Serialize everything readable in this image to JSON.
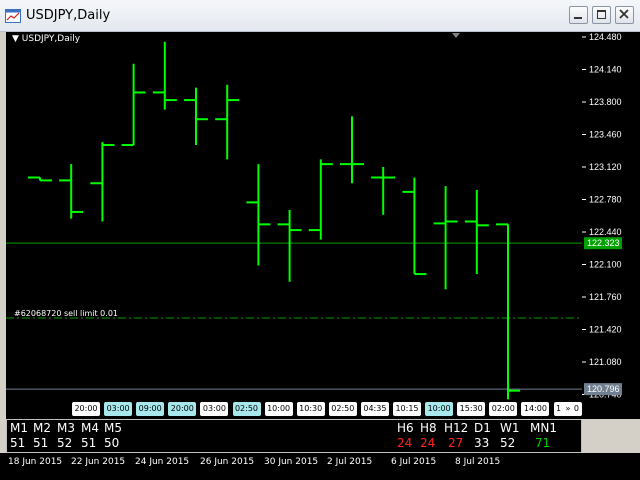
{
  "window": {
    "title": "USDJPY,Daily"
  },
  "chart": {
    "symbol_label": "USDJPY,Daily",
    "colors": {
      "bar": "#00ff00",
      "background": "#000000",
      "grid_line": "#00a000",
      "ask_line": "#708090"
    },
    "price_labels": [
      "124.480",
      "124.140",
      "123.800",
      "123.460",
      "123.120",
      "122.780",
      "122.440",
      "122.100",
      "121.760",
      "121.420",
      "121.080",
      "120.740"
    ],
    "bid_marker": "122.323",
    "ask_marker": "120.796",
    "order_label": "#62068720 sell limit 0.01",
    "bars": [
      {
        "o": 123.01,
        "h": 123.01,
        "l": 122.98,
        "c": 122.98
      },
      {
        "o": 122.98,
        "h": 123.15,
        "l": 122.58,
        "c": 122.65
      },
      {
        "o": 122.95,
        "h": 123.38,
        "l": 122.55,
        "c": 123.35
      },
      {
        "o": 123.35,
        "h": 124.2,
        "l": 123.35,
        "c": 123.9
      },
      {
        "o": 123.9,
        "h": 124.43,
        "l": 123.72,
        "c": 123.82
      },
      {
        "o": 123.82,
        "h": 123.95,
        "l": 123.35,
        "c": 123.62
      },
      {
        "o": 123.62,
        "h": 123.98,
        "l": 123.2,
        "c": 123.82
      },
      {
        "o": 122.75,
        "h": 123.15,
        "l": 122.09,
        "c": 122.52
      },
      {
        "o": 122.52,
        "h": 122.67,
        "l": 121.92,
        "c": 122.46
      },
      {
        "o": 122.46,
        "h": 123.2,
        "l": 122.36,
        "c": 123.15
      },
      {
        "o": 123.15,
        "h": 123.65,
        "l": 122.95,
        "c": 123.15
      },
      {
        "o": 123.01,
        "h": 123.12,
        "l": 122.62,
        "c": 123.01
      },
      {
        "o": 122.86,
        "h": 123.01,
        "l": 122.0,
        "c": 122.0
      },
      {
        "o": 122.53,
        "h": 122.92,
        "l": 121.84,
        "c": 122.55
      },
      {
        "o": 122.55,
        "h": 122.88,
        "l": 122.0,
        "c": 122.51
      },
      {
        "o": 122.52,
        "h": 122.52,
        "l": 120.69,
        "c": 120.78
      }
    ],
    "time_chips": [
      {
        "label": "20:00",
        "style": "w"
      },
      {
        "label": "03:00",
        "style": "c"
      },
      {
        "label": "09:00",
        "style": "c"
      },
      {
        "label": "20:00",
        "style": "c"
      },
      {
        "label": "03:00",
        "style": "w"
      },
      {
        "label": "02:50",
        "style": "c"
      },
      {
        "label": "10:00",
        "style": "w"
      },
      {
        "label": "10:30",
        "style": "w"
      },
      {
        "label": "02:50",
        "style": "w"
      },
      {
        "label": "04:35",
        "style": "w"
      },
      {
        "label": "10:15",
        "style": "w"
      },
      {
        "label": "10:00",
        "style": "c"
      },
      {
        "label": "15:30",
        "style": "w"
      },
      {
        "label": "02:00",
        "style": "w"
      },
      {
        "label": "14:00",
        "style": "w"
      },
      {
        "label": "11:30",
        "style": "w"
      }
    ]
  },
  "indicator_panel": {
    "left": [
      {
        "tf": "M1",
        "value": "51"
      },
      {
        "tf": "M2",
        "value": "51"
      },
      {
        "tf": "M3",
        "value": "52"
      },
      {
        "tf": "M4",
        "value": "51"
      },
      {
        "tf": "M5",
        "value": "50"
      }
    ],
    "right": [
      {
        "tf": "H6",
        "value": "24",
        "color": "#ff2020"
      },
      {
        "tf": "H8",
        "value": "24",
        "color": "#ff2020"
      },
      {
        "tf": "H12",
        "value": "27",
        "color": "#ff2020"
      },
      {
        "tf": "D1",
        "value": "33",
        "color": "#ffffff"
      },
      {
        "tf": "W1",
        "value": "52",
        "color": "#ffffff"
      },
      {
        "tf": "MN1",
        "value": "71",
        "color": "#00cc00"
      }
    ]
  },
  "date_axis": [
    "18 Jun 2015",
    "22 Jun 2015",
    "24 Jun 2015",
    "26 Jun 2015",
    "30 Jun 2015",
    "2 Jul 2015",
    "6 Jul 2015",
    "8 Jul 2015"
  ]
}
